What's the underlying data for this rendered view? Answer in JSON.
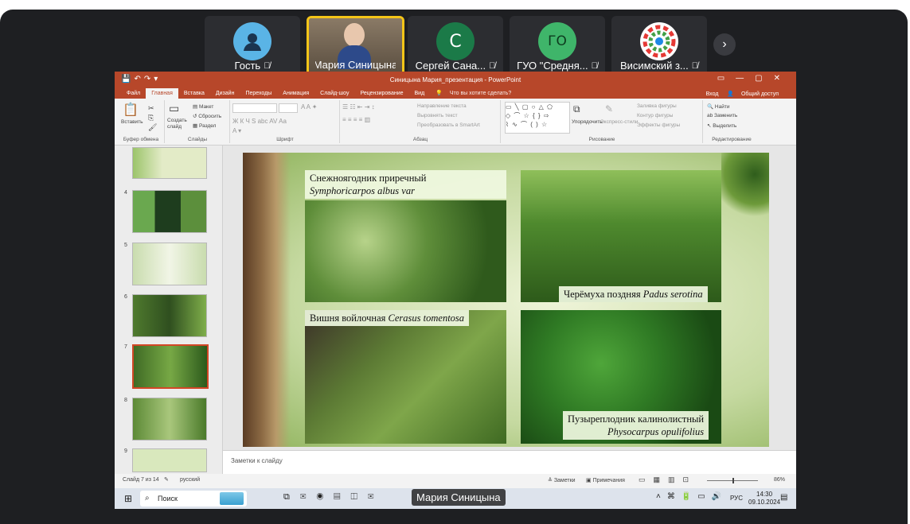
{
  "participants": [
    {
      "name": "Гость",
      "initials": "",
      "avatar_color": "#5ab4e6"
    },
    {
      "name": "Мария Синицына",
      "initials": "",
      "avatar_color": "#7a6a55"
    },
    {
      "name": "Сергей Сана...",
      "initials": "С",
      "avatar_color": "#1b7a48"
    },
    {
      "name": "ГУО \"Средня...",
      "initials": "ГО",
      "avatar_color": "#3fb56a"
    },
    {
      "name": "Висимский з...",
      "initials": "",
      "avatar_color": "#ffffff"
    }
  ],
  "ppt": {
    "window_title": "Синицына Мария_презентация - PowerPoint",
    "tabs": [
      "Файл",
      "Главная",
      "Вставка",
      "Дизайн",
      "Переходы",
      "Анимация",
      "Слайд-шоу",
      "Рецензирование",
      "Вид"
    ],
    "tell_me": "Что вы хотите сделать?",
    "sign_in": "Вход",
    "share": "Общий доступ",
    "ribbon": {
      "clipboard": {
        "paste": "Вставить",
        "label": "Буфер обмена"
      },
      "slides": {
        "new": "Создать слайд",
        "layout": "Макет",
        "reset": "Сбросить",
        "section": "Раздел",
        "label": "Слайды"
      },
      "font": {
        "label": "Шрифт"
      },
      "paragraph": {
        "dir": "Направление текста",
        "align": "Выровнять текст",
        "smartart": "Преобразовать в SmartArt",
        "label": "Абзац"
      },
      "drawing": {
        "arrange": "Упорядочить",
        "styles": "Экспресс-стили",
        "fill": "Заливка фигуры",
        "outline": "Контур фигуры",
        "effects": "Эффекты фигуры",
        "label": "Рисование"
      },
      "editing": {
        "find": "Найти",
        "replace": "Заменить",
        "select": "Выделить",
        "label": "Редактирование"
      }
    },
    "thumb_numbers": [
      "4",
      "5",
      "6",
      "7",
      "8",
      "9"
    ],
    "slide": {
      "captions": {
        "c1_title": "Снежноягодник приречный",
        "c1_latin": "Symphoricarpos albus var",
        "c2_title": "Черёмуха поздняя",
        "c2_latin": "Padus serotina",
        "c3_title": "Вишня войлочная",
        "c3_latin": "Cerasus tomentosa",
        "c4_title": "Пузыреплодник калинолистный",
        "c4_latin": "Physocarpus opulifolius"
      }
    },
    "notes_placeholder": "Заметки к слайду",
    "status": {
      "slide": "Слайд 7 из 14",
      "lang": "русский",
      "notes": "Заметки",
      "comments": "Примечания",
      "zoom": "86%"
    }
  },
  "taskbar": {
    "search": "Поиск",
    "lang": "РУС",
    "time": "14:30",
    "date": "09.10.2024"
  },
  "speaker_label": "Мария Синицына"
}
